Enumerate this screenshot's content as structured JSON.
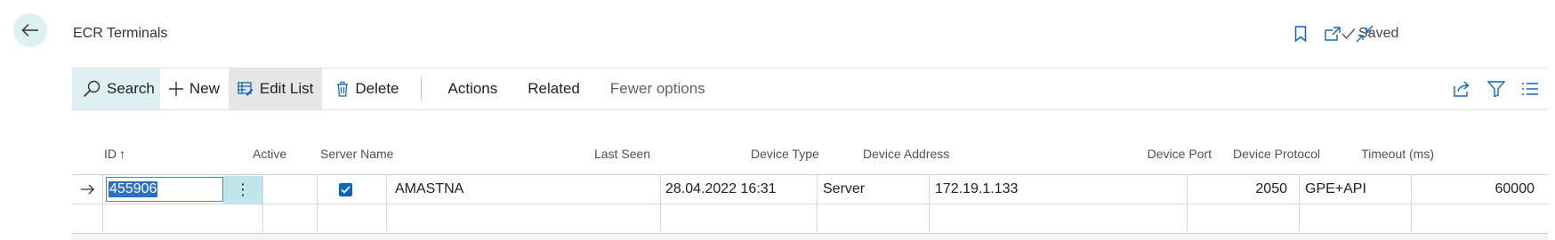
{
  "page": {
    "title": "ECR Terminals",
    "status": "Saved"
  },
  "toolbar": {
    "search": "Search",
    "new": "New",
    "edit_list": "Edit List",
    "delete": "Delete",
    "actions": "Actions",
    "related": "Related",
    "fewer_options": "Fewer options"
  },
  "columns": {
    "id": "ID",
    "sort_indicator": "↑",
    "active": "Active",
    "server_name": "Server Name",
    "last_seen": "Last Seen",
    "device_type": "Device Type",
    "device_address": "Device Address",
    "device_port": "Device Port",
    "device_protocol": "Device Protocol",
    "timeout": "Timeout (ms)"
  },
  "rows": [
    {
      "id": "455906",
      "active": true,
      "server_name": "AMASTNA",
      "last_seen": "28.04.2022 16:31",
      "device_type": "Server",
      "device_address": "172.19.1.133",
      "device_port": "2050",
      "device_protocol": "GPE+API",
      "timeout": "60000"
    }
  ],
  "colors": {
    "accent_bg": "#dff0f2",
    "checkbox": "#0b66c3",
    "selection": "#2a6fc9"
  },
  "icons": [
    "back-arrow-icon",
    "checkmark-icon",
    "bookmark-icon",
    "open-new-window-icon",
    "collapse-icon",
    "search-icon",
    "plus-icon",
    "edit-list-icon",
    "trash-icon",
    "share-icon",
    "filter-icon",
    "list-view-icon",
    "row-arrow-icon",
    "more-options-icon",
    "checkbox-checked-icon"
  ]
}
